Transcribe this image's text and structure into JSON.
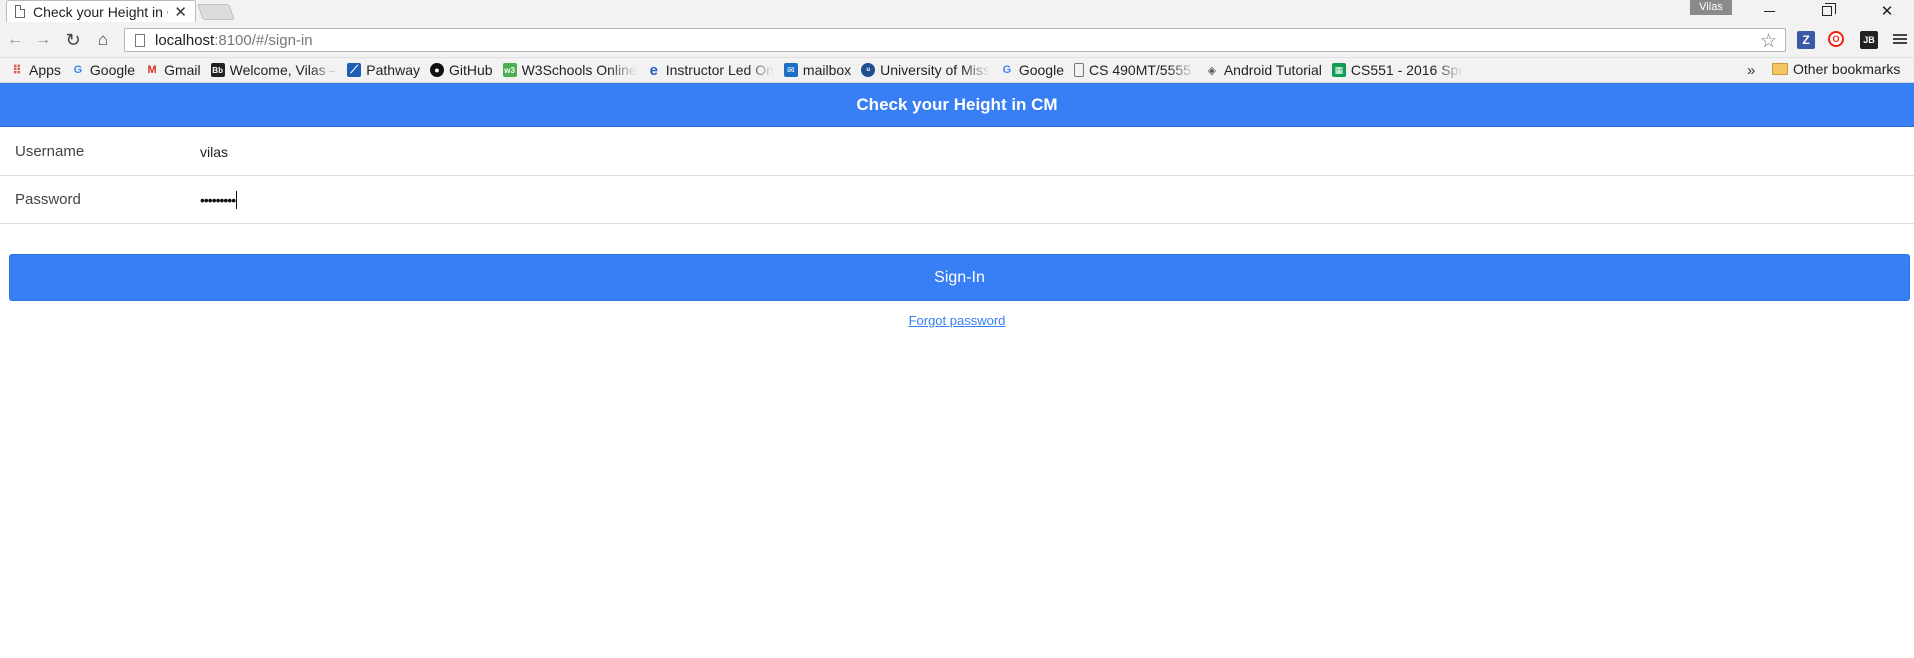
{
  "browser": {
    "tab_title": "Check your Height in CM",
    "tab_close": "✕",
    "profile_name": "Vilas",
    "url_host": "localhost",
    "url_path": ":8100/#/sign-in",
    "bookmarks": [
      {
        "label": "Apps",
        "icon": "apps-grid-icon"
      },
      {
        "label": "Google",
        "icon": "google-icon"
      },
      {
        "label": "Gmail",
        "icon": "gmail-icon"
      },
      {
        "label": "Welcome, Vilas –",
        "icon": "bb-icon"
      },
      {
        "label": "Pathway",
        "icon": "pathway-icon"
      },
      {
        "label": "GitHub",
        "icon": "github-icon"
      },
      {
        "label": "W3Schools Online",
        "icon": "w3schools-icon"
      },
      {
        "label": "Instructor Led On",
        "icon": "e-icon"
      },
      {
        "label": "mailbox",
        "icon": "mail-icon"
      },
      {
        "label": "University of Miss",
        "icon": "umkc-icon"
      },
      {
        "label": "Google",
        "icon": "google-icon"
      },
      {
        "label": "CS 490MT/5555:",
        "icon": "page-icon"
      },
      {
        "label": "Android Tutorial",
        "icon": "android-tutorial-icon"
      },
      {
        "label": "CS551 - 2016 Spr",
        "icon": "sheets-icon"
      }
    ],
    "bookmarks_more": "»",
    "other_bookmarks": "Other bookmarks",
    "extensions": {
      "z": "Z",
      "o": "O",
      "jb": "JB"
    }
  },
  "app": {
    "header_title": "Check your Height in CM",
    "username_label": "Username",
    "username_value": "vilas",
    "password_label": "Password",
    "password_masked": "•••••••••",
    "signin_label": "Sign-In",
    "forgot_label": "Forgot password"
  },
  "colors": {
    "primary": "#387ef5",
    "chrome": "#f2f2f2"
  }
}
